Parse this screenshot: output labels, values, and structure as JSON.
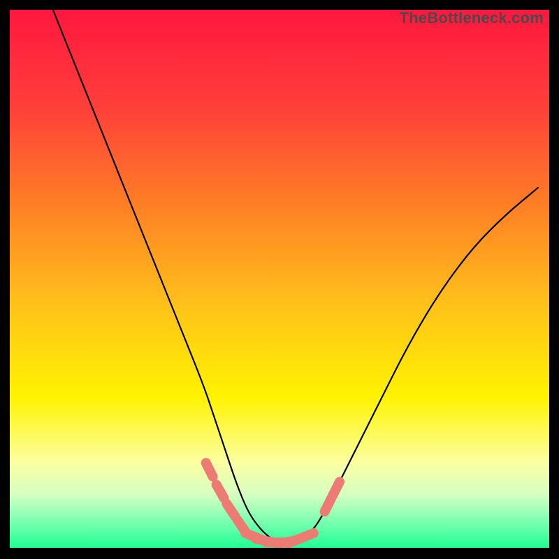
{
  "watermark": "TheBottleneck.com",
  "chart_data": {
    "type": "line",
    "title": "",
    "xlabel": "",
    "ylabel": "",
    "xlim": [
      0,
      100
    ],
    "ylim": [
      0,
      100
    ],
    "grid": false,
    "series": [
      {
        "name": "bottleneck-curve",
        "color": "#000000",
        "x": [
          8,
          12,
          16,
          20,
          24,
          28,
          32,
          36,
          38,
          40,
          42,
          44,
          46,
          48,
          50,
          52,
          54,
          56,
          58,
          62,
          68,
          74,
          80,
          86,
          92,
          98
        ],
        "y": [
          100,
          90,
          80,
          70,
          60,
          50,
          40,
          30,
          24,
          18,
          12,
          7,
          4,
          2,
          1,
          1,
          2,
          3,
          6,
          14,
          26,
          38,
          48,
          56,
          62,
          67
        ]
      }
    ],
    "markers": [
      {
        "name": "left-segment-markers",
        "color": "#ec7b74",
        "points": [
          {
            "x": 37,
            "y": 14.5
          },
          {
            "x": 39,
            "y": 10.5
          },
          {
            "x": 41,
            "y": 7
          },
          {
            "x": 43,
            "y": 4
          }
        ]
      },
      {
        "name": "bottom-markers",
        "color": "#ec7b74",
        "points": [
          {
            "x": 45,
            "y": 2.2
          },
          {
            "x": 47,
            "y": 1.4
          },
          {
            "x": 49,
            "y": 1.0
          },
          {
            "x": 51,
            "y": 1.0
          },
          {
            "x": 53,
            "y": 1.4
          },
          {
            "x": 55,
            "y": 2.2
          }
        ]
      },
      {
        "name": "right-segment-markers",
        "color": "#ec7b74",
        "points": [
          {
            "x": 59,
            "y": 8
          },
          {
            "x": 60.5,
            "y": 11
          }
        ]
      }
    ],
    "background_gradient": {
      "stops": [
        {
          "offset": 0.0,
          "color": "#ff173f"
        },
        {
          "offset": 0.18,
          "color": "#ff3f3a"
        },
        {
          "offset": 0.35,
          "color": "#ff7a26"
        },
        {
          "offset": 0.55,
          "color": "#ffc21a"
        },
        {
          "offset": 0.72,
          "color": "#fff300"
        },
        {
          "offset": 0.84,
          "color": "#fbffa0"
        },
        {
          "offset": 0.9,
          "color": "#d7ffc3"
        },
        {
          "offset": 0.95,
          "color": "#7dffb0"
        },
        {
          "offset": 1.0,
          "color": "#1fff94"
        }
      ]
    }
  }
}
